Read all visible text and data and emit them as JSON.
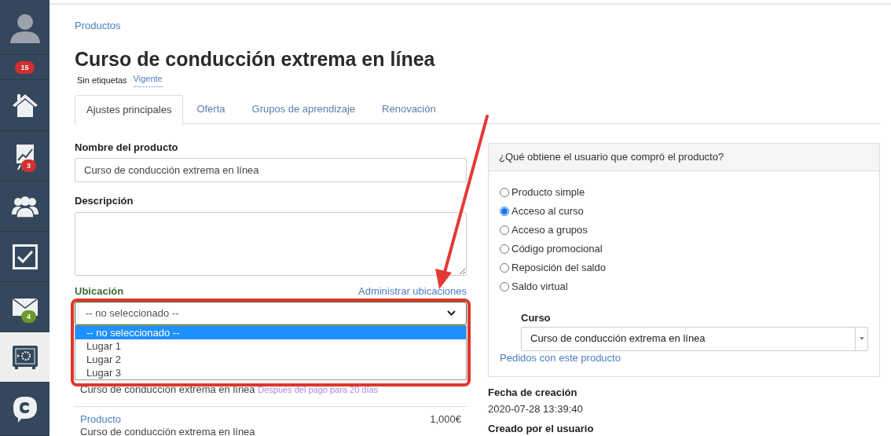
{
  "sidebar": {
    "items": [
      {
        "kind": "avatar",
        "selected": false
      },
      {
        "kind": "badge",
        "selected": false,
        "badge": "15",
        "color": "#d32f2f"
      },
      {
        "kind": "home",
        "selected": false
      },
      {
        "kind": "chart",
        "selected": false,
        "badge": "3",
        "color": "#d32f2f"
      },
      {
        "kind": "users",
        "selected": false
      },
      {
        "kind": "check",
        "selected": false
      },
      {
        "kind": "mail",
        "selected": false,
        "badge": "4",
        "color": "#6a9a2a"
      },
      {
        "kind": "safe",
        "selected": true
      },
      {
        "kind": "chat",
        "selected": false
      }
    ]
  },
  "breadcrumb": "Productos",
  "title": "Curso de conducción extrema en línea",
  "tags": {
    "label": "Sin etiquetas",
    "status": "Vigente"
  },
  "tabs": [
    {
      "label": "Ajustes principales",
      "selected": true
    },
    {
      "label": "Oferta",
      "selected": false
    },
    {
      "label": "Grupos de aprendizaje",
      "selected": false
    },
    {
      "label": "Renovación",
      "selected": false
    }
  ],
  "form": {
    "name_label": "Nombre del producto",
    "name_value": "Curso de conducción extrema en línea",
    "description_label": "Descripción",
    "location_label": "Ubicación",
    "manage_link": "Administrar ubicaciones",
    "location_value": "-- no seleccionado --",
    "location_options": [
      {
        "label": "-- no seleccionado --",
        "selected": true
      },
      {
        "label": "Lugar 1",
        "selected": false
      },
      {
        "label": "Lugar 2",
        "selected": false
      },
      {
        "label": "Lugar 3",
        "selected": false
      }
    ],
    "offer": {
      "name": "Curso de conducción extrema en línea",
      "note": "Después del pago para 20 días"
    },
    "price_row": {
      "label": "Producto",
      "price": "1,000€",
      "name": "Curso de conducción extrema en línea"
    }
  },
  "panel": {
    "header": "¿Qué obtiene el usuario que compró el producto?",
    "options": [
      {
        "label": "Producto simple",
        "selected": false
      },
      {
        "label": "Acceso al curso",
        "selected": true
      },
      {
        "label": "Acceso a grupos",
        "selected": false
      },
      {
        "label": "Código promocional",
        "selected": false
      },
      {
        "label": "Reposición del saldo",
        "selected": false
      },
      {
        "label": "Saldo virtual",
        "selected": false
      }
    ],
    "course_label": "Curso",
    "course_value": "Curso de conducción extrema en línea",
    "orders_link": "Pedidos con este producto"
  },
  "meta": [
    {
      "label": "Fecha de creación",
      "value": "2020-07-28 13:39:40"
    },
    {
      "label": "Creado por el usuario"
    }
  ]
}
